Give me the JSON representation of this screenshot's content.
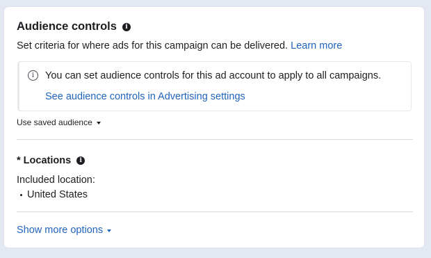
{
  "header": {
    "title": "Audience controls",
    "subtitle": "Set criteria for where ads for this campaign can be delivered.",
    "learn_more": "Learn more"
  },
  "notice": {
    "icon": "info-circle-icon",
    "text": "You can set audience controls for this ad account to apply to all campaigns.",
    "link": "See audience controls in Advertising settings"
  },
  "saved_audience": {
    "label": "Use saved audience"
  },
  "locations": {
    "title": "* Locations",
    "included_label": "Included location:",
    "items": [
      "United States"
    ]
  },
  "more_options": {
    "label": "Show more options"
  },
  "colors": {
    "link": "#2064bd",
    "text": "#1c1e21",
    "background": "#e4e8f3"
  }
}
